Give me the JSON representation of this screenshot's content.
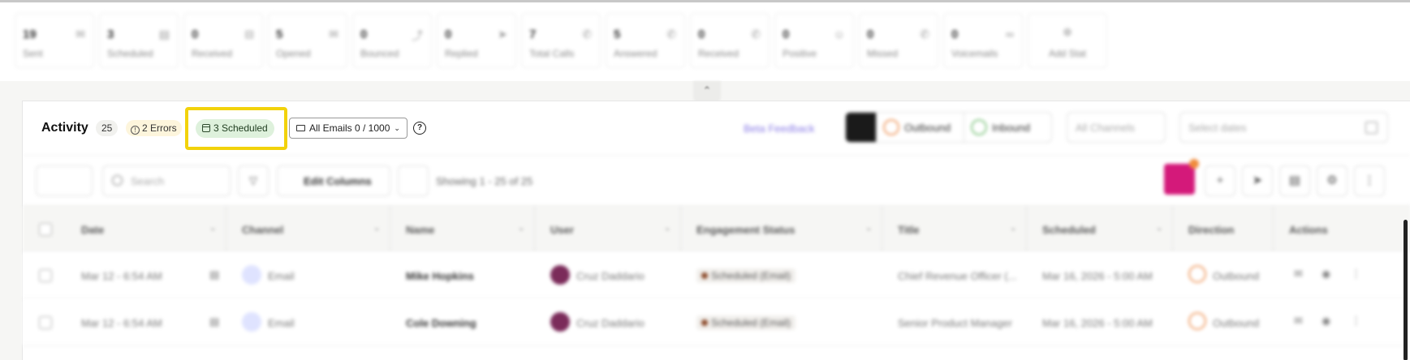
{
  "stats": [
    {
      "value": "19",
      "label": "Sent",
      "icon": "mail-icon"
    },
    {
      "value": "3",
      "label": "Scheduled",
      "icon": "calendar-icon"
    },
    {
      "value": "0",
      "label": "Received",
      "icon": "inbox-icon"
    },
    {
      "value": "5",
      "label": "Opened",
      "icon": "mail-open-icon"
    },
    {
      "value": "0",
      "label": "Bounced",
      "icon": "bounce-icon"
    },
    {
      "value": "0",
      "label": "Replied",
      "icon": "send-icon"
    },
    {
      "value": "7",
      "label": "Total Calls",
      "icon": "phone-icon"
    },
    {
      "value": "5",
      "label": "Answered",
      "icon": "phone-answered-icon"
    },
    {
      "value": "0",
      "label": "Received",
      "icon": "phone-incoming-icon"
    },
    {
      "value": "0",
      "label": "Positive",
      "icon": "smile-icon"
    },
    {
      "value": "0",
      "label": "Missed",
      "icon": "phone-missed-icon"
    },
    {
      "value": "0",
      "label": "Voicemails",
      "icon": "voicemail-icon"
    }
  ],
  "add_stat_label": "Add Stat",
  "activity": {
    "title": "Activity",
    "count": "25",
    "errors_label": "2 Errors",
    "scheduled_label": "3 Scheduled",
    "emails_label": "All Emails 0 / 1000",
    "help": "?"
  },
  "beta_feedback": "Beta Feedback",
  "direction": {
    "outbound": "Outbound",
    "inbound": "Inbound"
  },
  "channels_placeholder": "All Channels",
  "dates_placeholder": "Select dates",
  "toolbar": {
    "search_placeholder": "Search",
    "edit_columns": "Edit Columns",
    "showing": "Showing 1 - 25 of 25"
  },
  "columns": [
    "Date",
    "Channel",
    "Name",
    "User",
    "Engagement Status",
    "Title",
    "Scheduled",
    "Direction",
    "Actions"
  ],
  "rows": [
    {
      "date": "Mar 12 - 6:54 AM",
      "channel": "Email",
      "name": "Mike Hopkins",
      "user": "Cruz Daddario",
      "status": "Scheduled (Email)",
      "title": "Chief Revenue Officer (...",
      "scheduled": "Mar 16, 2026 - 5:00 AM",
      "direction": "Outbound"
    },
    {
      "date": "Mar 12 - 6:54 AM",
      "channel": "Email",
      "name": "Cole Downing",
      "user": "Cruz Daddario",
      "status": "Scheduled (Email)",
      "title": "Senior Product Manager",
      "scheduled": "Mar 16, 2026 - 5:00 AM",
      "direction": "Outbound"
    }
  ],
  "colors": {
    "highlight": "#f2d20b",
    "scheduled_bg": "#def1dc",
    "errors_bg": "#fdf5dc",
    "brand_pink": "#d4197a"
  }
}
